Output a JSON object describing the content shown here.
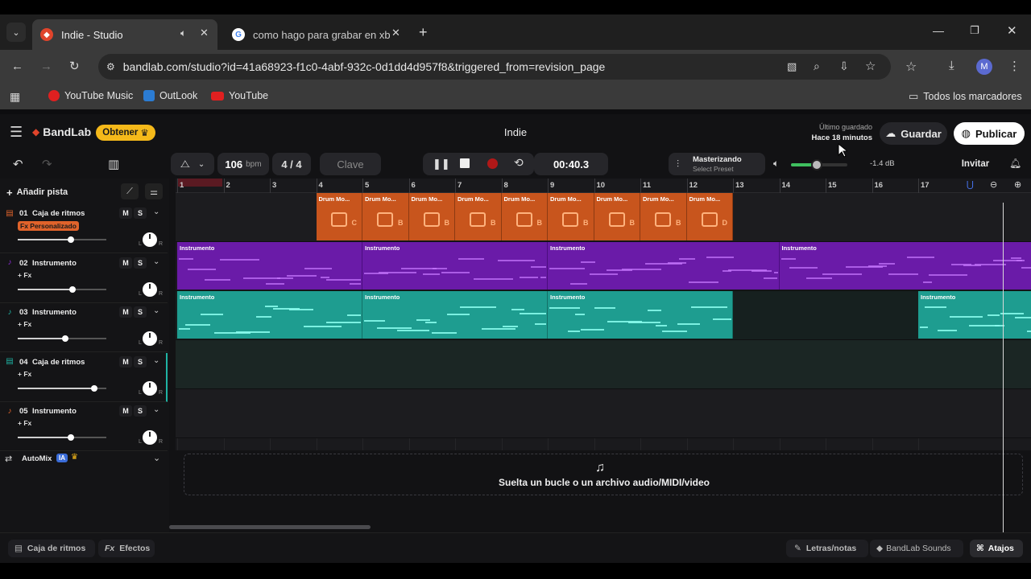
{
  "browser": {
    "tabs": [
      {
        "title": "Indie - Studio",
        "active": true
      },
      {
        "title": "como hago para grabar en xbo",
        "active": false
      }
    ],
    "url": "bandlab.com/studio?id=41a68923-f1c0-4abf-932c-0d1dd4d957f8&triggered_from=revision_page",
    "bookmarks": [
      {
        "label": "YouTube Music",
        "icon": "youtube-music-icon"
      },
      {
        "label": "OutLook",
        "icon": "outlook-icon"
      },
      {
        "label": "YouTube",
        "icon": "youtube-icon"
      }
    ],
    "all_bookmarks_label": "Todos los marcadores",
    "profile_initial": "M"
  },
  "app": {
    "logo": "BandLab",
    "get_button": "Obtener",
    "project_title": "Indie",
    "saved_label": "Último guardado",
    "saved_time": "Hace 18 minutos",
    "save_button": "Guardar",
    "publish_button": "Publicar",
    "bpm": "106",
    "bpm_unit": "bpm",
    "time_signature": "4 / 4",
    "key_button": "Clave",
    "time_display": "00:40.3",
    "mastering_title": "Masterizando",
    "mastering_sub": "Select Preset",
    "volume_db": "-1.4 dB",
    "volume_level": 0.45,
    "invite_button": "Invitar",
    "add_track": "Añadir pista",
    "automix_label": "AutoMix",
    "automix_badge": "IA",
    "drop_text": "Suelta un bucle o un archivo audio/MIDI/video",
    "bottom": {
      "drum_machine": "Caja de ritmos",
      "effects_prefix": "Fx",
      "effects": "Efectos",
      "lyrics": "Letras/notas",
      "sounds": "BandLab Sounds",
      "shortcuts": "Atajos"
    },
    "colors": {
      "accent_orange": "#c8551d",
      "accent_purple": "#6a1ba8",
      "accent_teal": "#1e9d90",
      "get_yellow": "#f5b91a"
    }
  },
  "tracks": [
    {
      "num": "01",
      "name": "Caja de ritmos",
      "fx": "Fx Personalizado",
      "fx_custom": true,
      "volume": 0.6,
      "color": "#e0632b"
    },
    {
      "num": "02",
      "name": "Instrumento",
      "fx": "+ Fx",
      "fx_custom": false,
      "volume": 0.62,
      "color": "#8b2bd6"
    },
    {
      "num": "03",
      "name": "Instrumento",
      "fx": "+ Fx",
      "fx_custom": false,
      "volume": 0.54,
      "color": "#1fb3a3"
    },
    {
      "num": "04",
      "name": "Caja de ritmos",
      "fx": "+ Fx",
      "fx_custom": false,
      "volume": 0.86,
      "color": "#1fb3a3"
    },
    {
      "num": "05",
      "name": "Instrumento",
      "fx": "+ Fx",
      "fx_custom": false,
      "volume": 0.6,
      "color": "#e0632b"
    }
  ],
  "ruler_bars": [
    "1",
    "2",
    "3",
    "4",
    "5",
    "6",
    "7",
    "8",
    "9",
    "10",
    "11",
    "12",
    "13",
    "14",
    "15",
    "16",
    "17"
  ],
  "clips": {
    "drum_label": "Drum Mo...",
    "drum_letters": [
      "C",
      "B",
      "B",
      "B",
      "B",
      "B",
      "B",
      "B",
      "D"
    ],
    "instrument_label": "Instrumento"
  },
  "mute_label": "M",
  "solo_label": "S"
}
